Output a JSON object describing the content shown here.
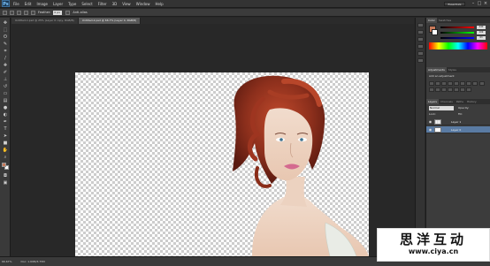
{
  "app": {
    "logo": "Ps"
  },
  "menu": [
    "File",
    "Edit",
    "Image",
    "Layer",
    "Type",
    "Select",
    "Filter",
    "3D",
    "View",
    "Window",
    "Help"
  ],
  "workspace": {
    "label": "Essentials"
  },
  "options": {
    "feather_label": "Feather:",
    "feather_value": "0 px",
    "antialias_label": "Anti-alias"
  },
  "tabs": [
    {
      "label": "Untitled-1.psd @ 25% (Layer 0 copy, RGB/8)",
      "active": false
    },
    {
      "label": "Untitled-2.psd @ 66.7% (Layer 0, RGB/8)",
      "active": true
    }
  ],
  "status": {
    "zoom": "66.67%",
    "doc": "Doc: 1.69M/3.75M"
  },
  "panels": {
    "color_tabs": [
      "Color",
      "Swatches"
    ],
    "color_values": [
      "240",
      "109",
      "83"
    ],
    "adjustments_tabs": [
      "Adjustments",
      "Styles"
    ],
    "adjustments_title": "Add an adjustment",
    "layers_tabs": [
      "Layers",
      "Channels",
      "Paths",
      "History"
    ],
    "blend_mode": "Normal",
    "opacity_label": "Opacity:",
    "lock_label": "Lock:",
    "fill_label": "Fill:",
    "layers": [
      {
        "name": "Layer 1",
        "selected": false
      },
      {
        "name": "Layer 0",
        "selected": true
      }
    ]
  },
  "watermark": {
    "chinese": "思洋互动",
    "url": "www.ciya.cn"
  },
  "colors": {
    "foreground": "#c87a5a",
    "background": "#ffffff",
    "accent": "#5a7ba3"
  },
  "icons": [
    "move-icon",
    "marquee-icon",
    "lasso-icon",
    "quick-select-icon",
    "crop-icon",
    "eyedropper-icon",
    "healing-icon",
    "brush-icon",
    "stamp-icon",
    "history-brush-icon",
    "eraser-icon",
    "gradient-icon",
    "blur-icon",
    "dodge-icon",
    "pen-icon",
    "type-icon",
    "path-select-icon",
    "shape-icon",
    "hand-icon",
    "zoom-icon"
  ]
}
